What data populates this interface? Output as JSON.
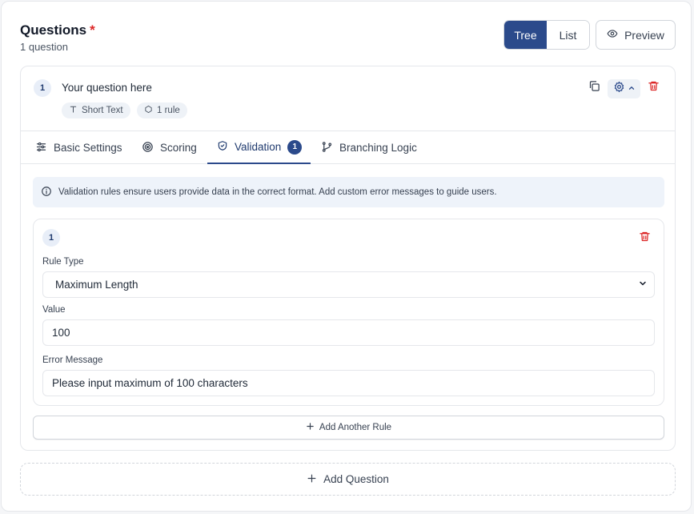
{
  "header": {
    "title": "Questions",
    "required_mark": "*",
    "subtitle": "1 question",
    "view_toggle": {
      "tree_label": "Tree",
      "list_label": "List",
      "active": "Tree"
    },
    "preview_label": "Preview"
  },
  "question": {
    "number": "1",
    "text": "Your question here",
    "chips": [
      {
        "icon": "text-type-icon",
        "label": "Short Text"
      },
      {
        "icon": "rule-icon",
        "label": "1 rule"
      }
    ]
  },
  "tabs": [
    {
      "icon": "sliders-icon",
      "label": "Basic Settings"
    },
    {
      "icon": "target-icon",
      "label": "Scoring"
    },
    {
      "icon": "shield-check-icon",
      "label": "Validation",
      "badge": "1",
      "active": true
    },
    {
      "icon": "git-branch-icon",
      "label": "Branching Logic"
    }
  ],
  "validation": {
    "info_text": "Validation rules ensure users provide data in the correct format. Add custom error messages to guide users.",
    "rule": {
      "number": "1",
      "rule_type_label": "Rule Type",
      "rule_type_value": "Maximum Length",
      "value_label": "Value",
      "value": "100",
      "error_label": "Error Message",
      "error_value": "Please input maximum of 100 characters"
    },
    "add_rule_label": "Add Another Rule"
  },
  "add_question_label": "Add Question",
  "colors": {
    "primary": "#2b4a8b",
    "danger": "#dc2626",
    "info_bg": "#eef3fa"
  }
}
